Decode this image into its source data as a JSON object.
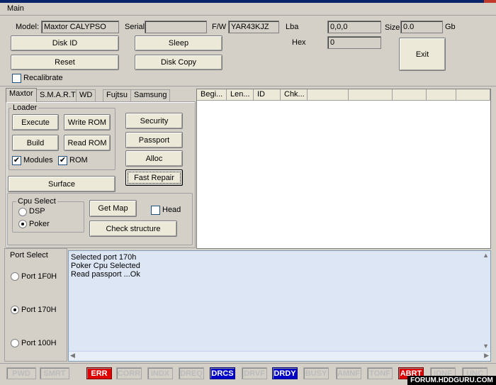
{
  "menu": {
    "main": "Main"
  },
  "colors": {
    "panel": "#d4d0c8",
    "log_bg": "#dde6f5",
    "active_red": "#e00000",
    "active_blue": "#0000c8"
  },
  "header": {
    "model_label": "Model:",
    "model_value": "Maxtor CALYPSO",
    "serial_label": "Serial",
    "serial_value": "",
    "fw_label": "F/W",
    "fw_value": "YAR43KJZ",
    "lba_label": "Lba",
    "lba_value": "0,0,0",
    "size_label": "Size",
    "size_value": "0.0",
    "size_unit": "Gb",
    "hex_label": "Hex",
    "hex_value": "0",
    "disk_id": "Disk ID",
    "sleep": "Sleep",
    "reset": "Reset",
    "disk_copy": "Disk Copy",
    "exit": "Exit",
    "recalibrate": "Recalibrate"
  },
  "tabs": [
    "Maxtor",
    "S.M.A.R.T",
    "WD",
    "Fujtsu",
    "Samsung"
  ],
  "table": {
    "columns": [
      "Begi...",
      "Len...",
      "ID",
      "Chk..."
    ]
  },
  "loader": {
    "title": "Loader",
    "execute": "Execute",
    "write_rom": "Write ROM",
    "build": "Build",
    "read_rom": "Read ROM",
    "modules": "Modules",
    "rom": "ROM"
  },
  "right_buttons": {
    "security": "Security",
    "passport": "Passport",
    "alloc": "Alloc",
    "fast_repair": "Fast Repair"
  },
  "surface": "Surface",
  "cpu": {
    "title": "Cpu Select",
    "dsp": "DSP",
    "poker": "Poker",
    "get_map": "Get Map",
    "head": "Head",
    "check_structure": "Check structure"
  },
  "port": {
    "title": "Port Select",
    "p1": "Port 1F0H",
    "p2": "Port 170H",
    "p3": "Port 100H"
  },
  "log": [
    "Selected port 170h",
    "Poker Cpu Selected",
    "Read passport ...Ok"
  ],
  "status": [
    {
      "label": "PWD",
      "state": "off"
    },
    {
      "label": "SMRT",
      "state": "off"
    },
    {
      "label": "ERR",
      "state": "red"
    },
    {
      "label": "CORR",
      "state": "off"
    },
    {
      "label": "INDX",
      "state": "off"
    },
    {
      "label": "DREQ",
      "state": "off"
    },
    {
      "label": "DRCS",
      "state": "blue"
    },
    {
      "label": "DRVF",
      "state": "off"
    },
    {
      "label": "DRDY",
      "state": "blue"
    },
    {
      "label": "BUSY",
      "state": "off"
    },
    {
      "label": "AMNF",
      "state": "off"
    },
    {
      "label": "TONF",
      "state": "off"
    },
    {
      "label": "ABRT",
      "state": "red"
    },
    {
      "label": "IDNF",
      "state": "off"
    },
    {
      "label": "UNC",
      "state": "off"
    }
  ],
  "watermark": "FORUM.HDDGURU.COM"
}
